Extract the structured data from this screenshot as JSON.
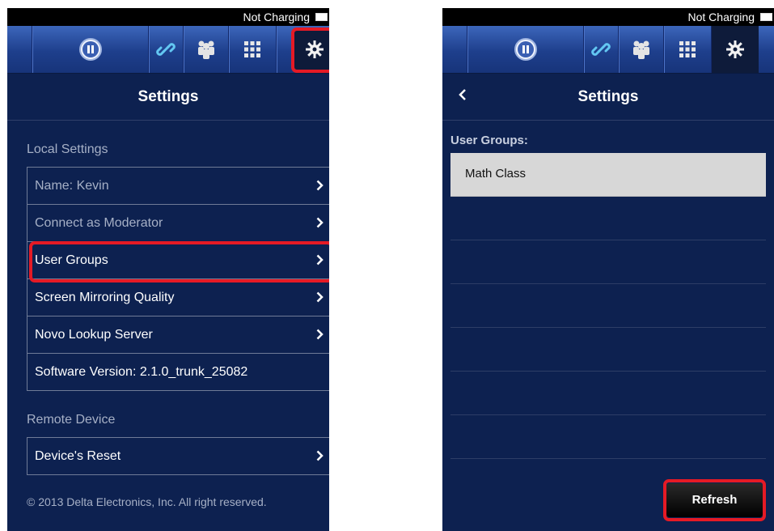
{
  "status_bar": {
    "text": "Not Charging"
  },
  "toolbar": {
    "buttons": [
      {
        "icon": "pause-icon"
      },
      {
        "icon": "link-icon"
      },
      {
        "icon": "group-icon"
      },
      {
        "icon": "grid-icon"
      },
      {
        "icon": "gear-icon"
      }
    ]
  },
  "left_screen": {
    "title": "Settings",
    "local_section": "Local Settings",
    "items": [
      {
        "label": "Name: Kevin",
        "disabled": true
      },
      {
        "label": "Connect as Moderator",
        "disabled": true
      },
      {
        "label": "User Groups"
      },
      {
        "label": "Screen Mirroring Quality"
      },
      {
        "label": "Novo Lookup Server"
      },
      {
        "label": "Software Version: 2.1.0_trunk_25082"
      }
    ],
    "remote_section": "Remote Device",
    "remote_items": [
      {
        "label": "Device's Reset"
      }
    ],
    "copyright": "© 2013 Delta Electronics, Inc. All right reserved."
  },
  "right_screen": {
    "title": "Settings",
    "groups_label": "User Groups:",
    "groups": [
      "Math Class"
    ],
    "refresh_label": "Refresh"
  },
  "colors": {
    "background": "#0d2150",
    "toolbar": "#2a4fa3",
    "highlight": "#e51a25",
    "selected_row": "#d7d7d7"
  }
}
